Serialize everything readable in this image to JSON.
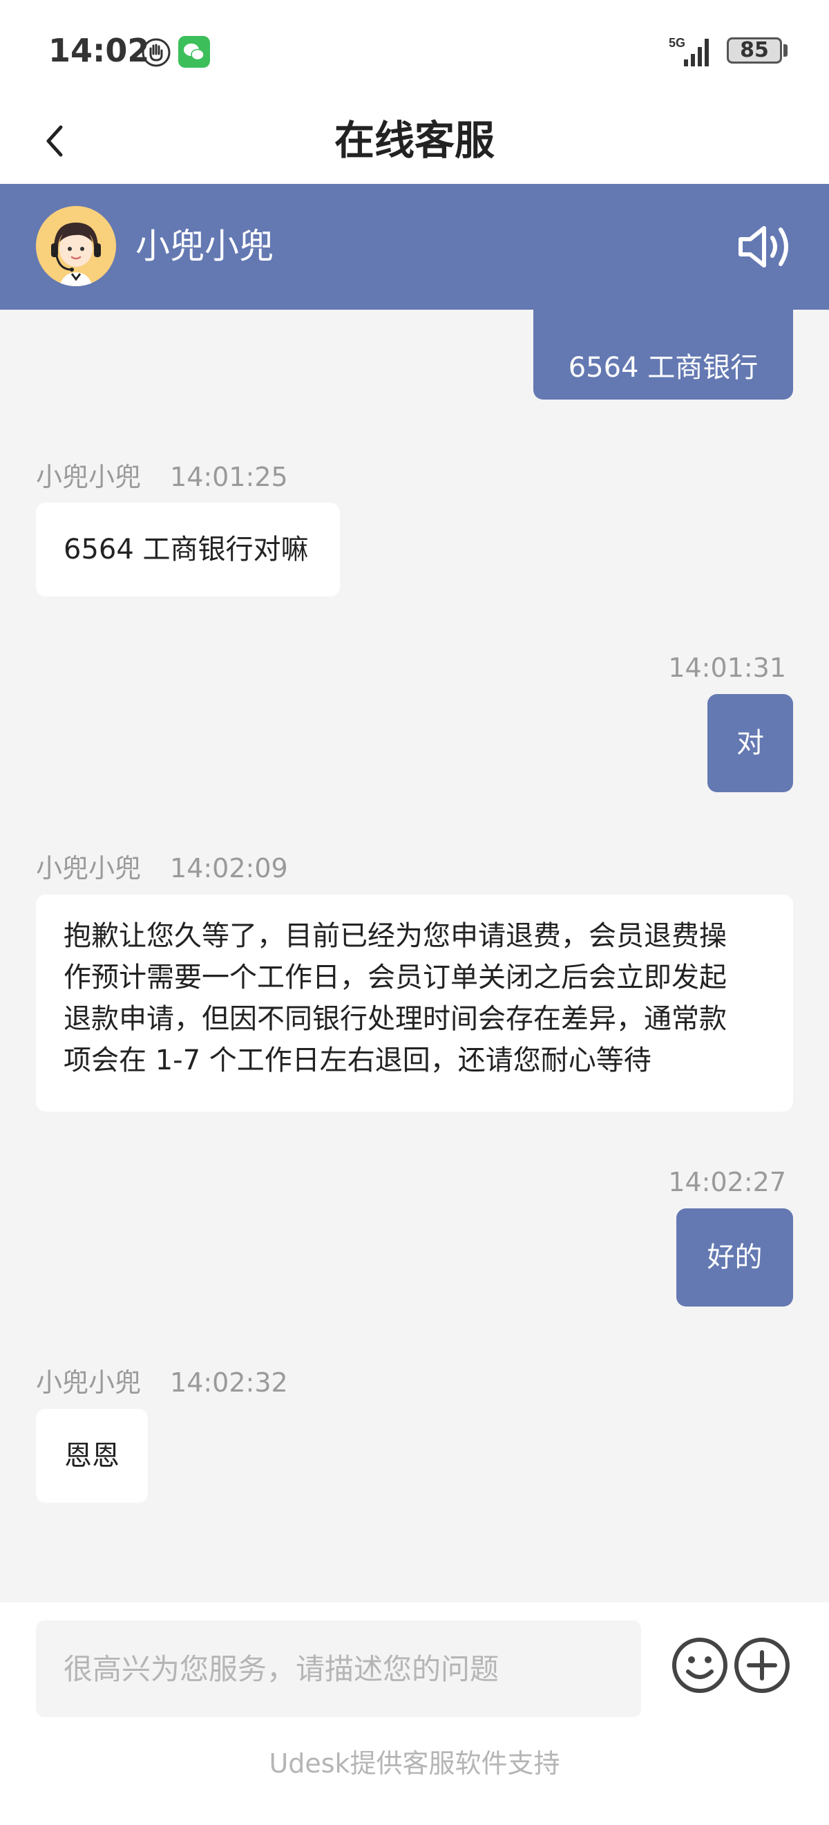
{
  "status_bar": {
    "time": "14:02",
    "network": "5G",
    "battery": "85"
  },
  "nav": {
    "title": "在线客服"
  },
  "agent": {
    "name": "小兜小兜"
  },
  "messages": [
    {
      "from": "user",
      "text": "6564 工商银行"
    },
    {
      "from": "agent",
      "sender": "小兜小兜",
      "time": "14:01:25",
      "text": "6564 工商银行对嘛"
    },
    {
      "from": "user",
      "time": "14:01:31",
      "text": "对"
    },
    {
      "from": "agent",
      "sender": "小兜小兜",
      "time": "14:02:09",
      "lines": [
        "抱歉让您久等了，目前已经为您申请退费，会员退费操",
        "作预计需要一个工作日，会员订单关闭之后会立即发起",
        "退款申请，但因不同银行处理时间会存在差异，通常款",
        "项会在 1-7 个工作日左右退回，还请您耐心等待"
      ]
    },
    {
      "from": "user",
      "time": "14:02:27",
      "text": "好的"
    },
    {
      "from": "agent",
      "sender": "小兜小兜",
      "time": "14:02:32",
      "text": "恩恩"
    }
  ],
  "input": {
    "placeholder": "很高兴为您服务，请描述您的问题"
  },
  "footer": {
    "text": "Udesk提供客服软件支持"
  },
  "colors": {
    "accent": "#6479b2",
    "background": "#f4f4f4",
    "bubble_in": "#ffffff"
  },
  "icons": [
    "hand-icon",
    "wechat-icon",
    "signal-icon",
    "battery-icon",
    "back-icon",
    "speaker-icon",
    "emoji-icon",
    "plus-icon"
  ]
}
